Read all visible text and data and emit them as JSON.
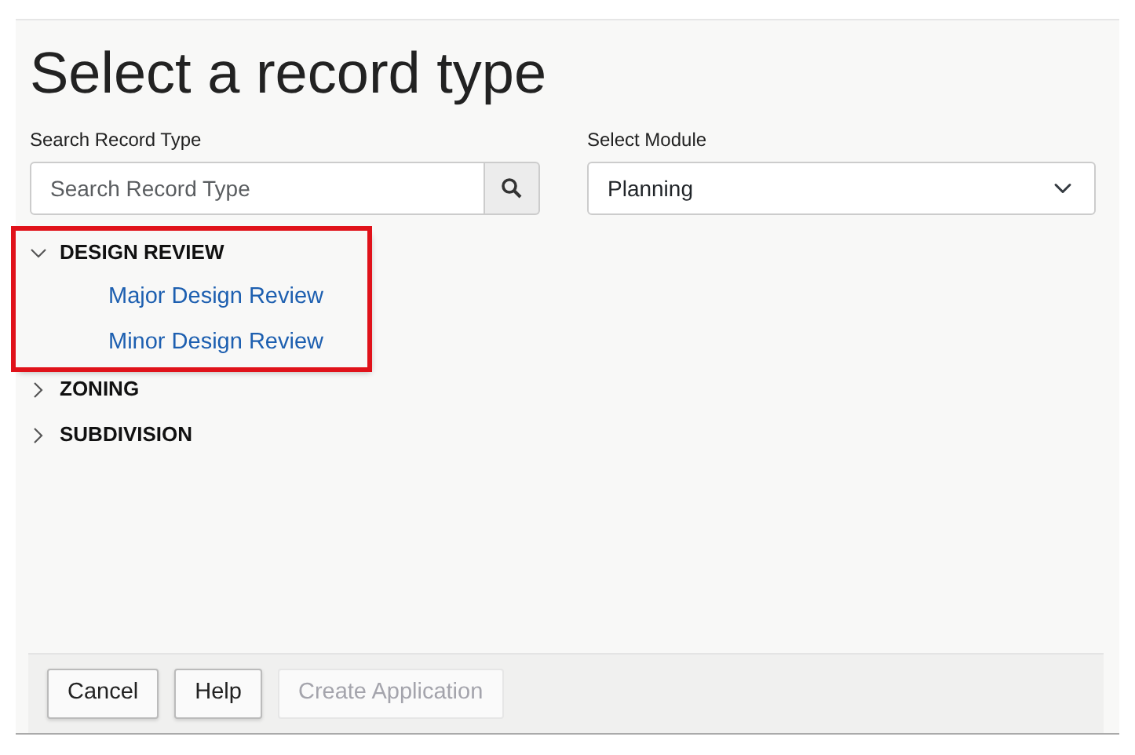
{
  "title": "Select a record type",
  "search": {
    "label": "Search Record Type",
    "placeholder": "Search Record Type"
  },
  "module": {
    "label": "Select Module",
    "value": "Planning"
  },
  "record_types": [
    {
      "label": "DESIGN REVIEW",
      "expanded": true,
      "highlighted": true,
      "children": [
        {
          "label": "Major Design Review"
        },
        {
          "label": "Minor Design Review"
        }
      ]
    },
    {
      "label": "ZONING",
      "expanded": false,
      "highlighted": false
    },
    {
      "label": "SUBDIVISION",
      "expanded": false,
      "highlighted": false
    }
  ],
  "buttons": [
    {
      "label": "Cancel",
      "disabled": false
    },
    {
      "label": "Help",
      "disabled": false
    },
    {
      "label": "Create Application",
      "disabled": true
    }
  ]
}
